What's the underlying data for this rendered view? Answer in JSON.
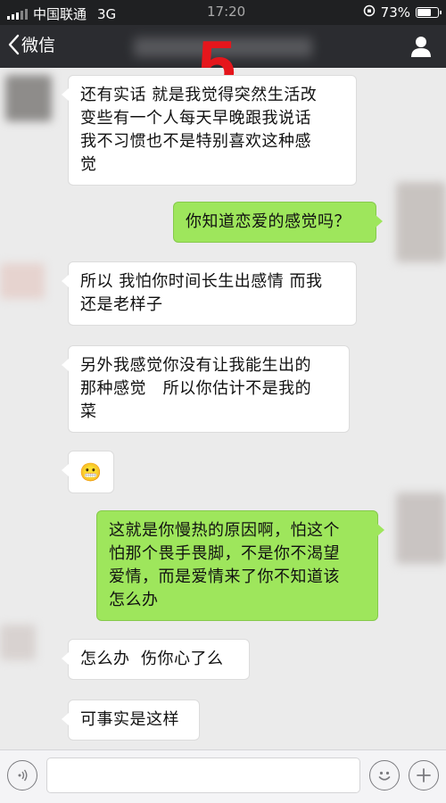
{
  "status_bar": {
    "carrier": "中国联通",
    "network": "3G",
    "time": "17:20",
    "battery": "73%",
    "battery_level": 0.73
  },
  "nav": {
    "back_label": "微信",
    "overlay_number": "5"
  },
  "messages": [
    {
      "side": "in",
      "text": "还有实话 就是我觉得突然生活改\n变些有一个人每天早晚跟我说话\n我不习惯也不是特别喜欢这种感\n觉"
    },
    {
      "side": "out",
      "text": "你知道恋爱的感觉吗？"
    },
    {
      "side": "in",
      "text": "所以 我怕你时间长生出感情 而我\n还是老样子"
    },
    {
      "side": "in",
      "text": "另外我感觉你没有让我能生出的\n那种感觉   所以你估计不是我的\n菜"
    },
    {
      "side": "in",
      "text": "😬"
    },
    {
      "side": "out",
      "text": "这就是你慢热的原因啊，怕这个\n怕那个畏手畏脚，不是你不渴望\n爱情，而是爱情来了你不知道该\n怎么办"
    },
    {
      "side": "in",
      "text": "怎么办  伤你心了么"
    },
    {
      "side": "in",
      "text": "可事实是这样"
    }
  ],
  "icons": {
    "back": "chevron-left-icon",
    "profile": "person-icon",
    "voice": "voice-icon",
    "emoji": "smiley-icon",
    "more": "plus-icon"
  },
  "colors": {
    "incoming_bubble": "#ffffff",
    "outgoing_bubble": "#9ee65c",
    "navbar": "#2b2c30",
    "overlay_number": "#e5161c"
  }
}
